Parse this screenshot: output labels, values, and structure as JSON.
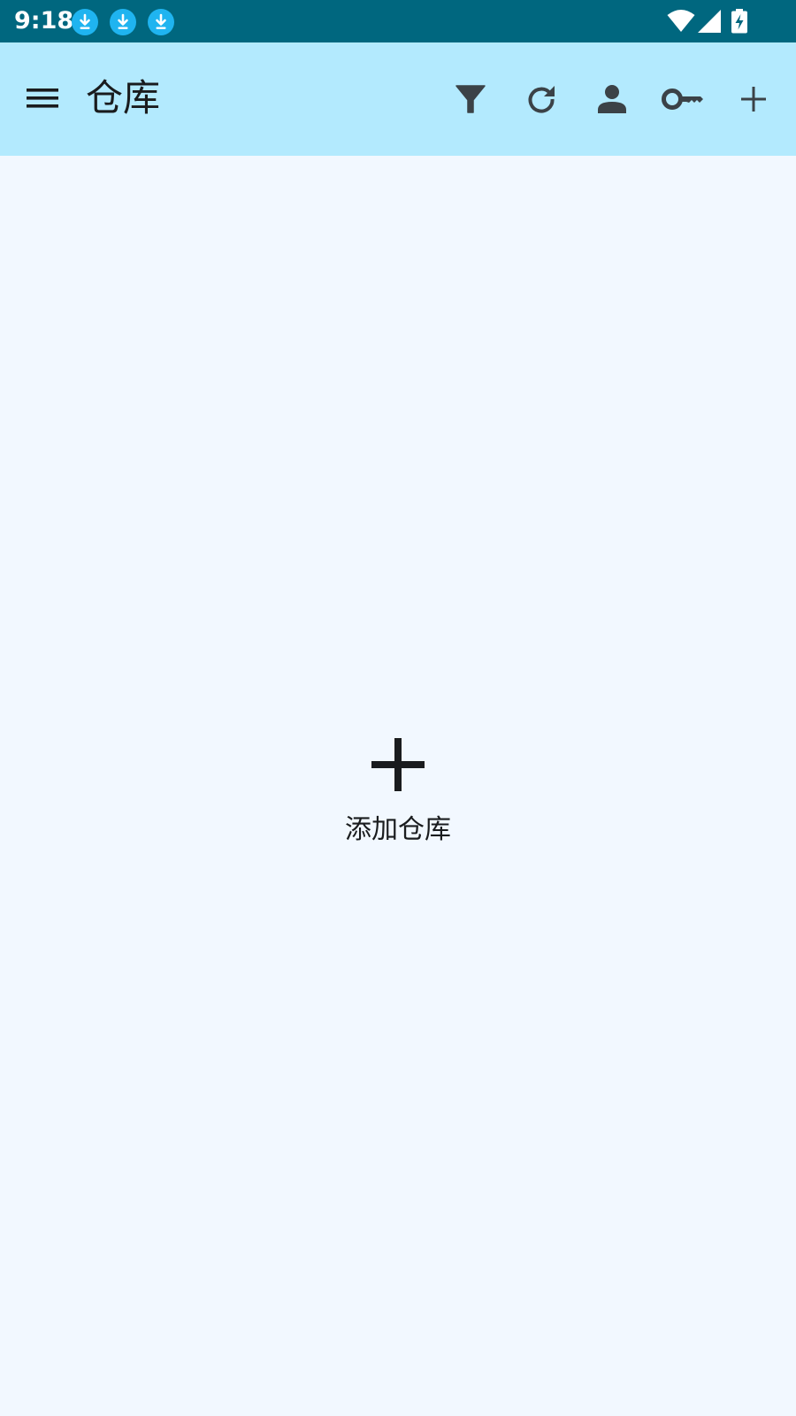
{
  "status_bar": {
    "time": "9:18",
    "notification_icons": [
      "download-icon",
      "download-icon",
      "download-icon"
    ],
    "system_icons": [
      "wifi-icon",
      "cell-signal-icon",
      "battery-charging-icon"
    ]
  },
  "app_bar": {
    "title": "仓库",
    "actions": [
      "filter-icon",
      "refresh-icon",
      "account-icon",
      "key-icon",
      "add-icon"
    ]
  },
  "empty_state": {
    "icon": "add-icon",
    "label": "添加仓库"
  },
  "colors": {
    "status_bar_bg": "#00677f",
    "app_bar_bg": "#b3eafe",
    "page_bg": "#f2f8ff",
    "download_badge": "#1fb4f0",
    "icon_dark": "#3b4247",
    "text_dark": "#1a1c1e"
  }
}
